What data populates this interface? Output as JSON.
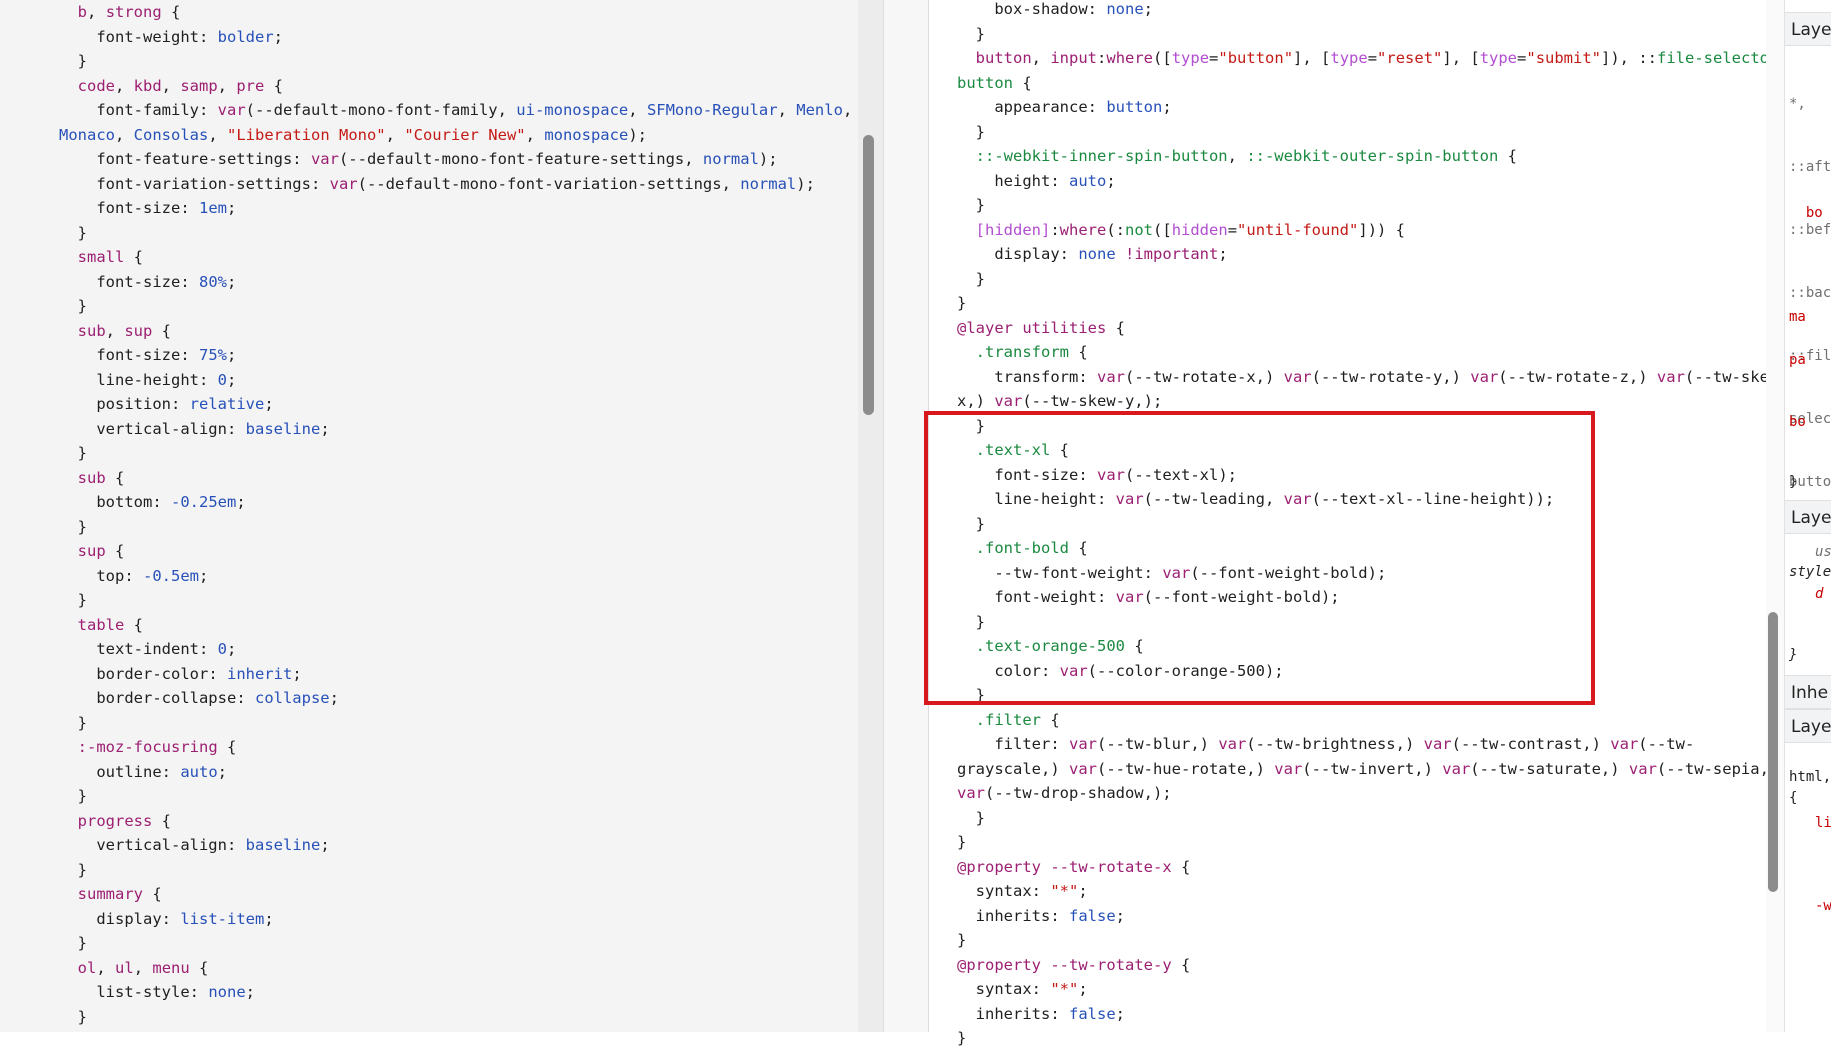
{
  "left_code_lines": [
    [
      [
        "  ",
        "t"
      ],
      [
        "b",
        "s"
      ],
      [
        ", ",
        "t"
      ],
      [
        "strong",
        "s"
      ],
      [
        " {",
        "t"
      ]
    ],
    [
      [
        "    ",
        "t"
      ],
      [
        "font-weight",
        "p"
      ],
      [
        ": ",
        "t"
      ],
      [
        "bolder",
        "v"
      ],
      [
        ";",
        "t"
      ]
    ],
    [
      [
        "  }",
        "t"
      ]
    ],
    [
      [
        "  ",
        "t"
      ],
      [
        "code",
        "s"
      ],
      [
        ", ",
        "t"
      ],
      [
        "kbd",
        "s"
      ],
      [
        ", ",
        "t"
      ],
      [
        "samp",
        "s"
      ],
      [
        ", ",
        "t"
      ],
      [
        "pre",
        "s"
      ],
      [
        " {",
        "t"
      ]
    ],
    [
      [
        "    ",
        "t"
      ],
      [
        "font-family",
        "p"
      ],
      [
        ": ",
        "t"
      ],
      [
        "var",
        "s"
      ],
      [
        "(--default-mono-font-family, ",
        "t"
      ],
      [
        "ui-monospace",
        "v"
      ],
      [
        ", ",
        "t"
      ],
      [
        "SFMono-Regular",
        "v"
      ],
      [
        ", ",
        "t"
      ],
      [
        "Menlo",
        "v"
      ],
      [
        ",",
        "t"
      ]
    ],
    [
      [
        "Monaco",
        "v"
      ],
      [
        ", ",
        "t"
      ],
      [
        "Consolas",
        "v"
      ],
      [
        ", ",
        "t"
      ],
      [
        "\"Liberation Mono\"",
        "q"
      ],
      [
        ", ",
        "t"
      ],
      [
        "\"Courier New\"",
        "q"
      ],
      [
        ", ",
        "t"
      ],
      [
        "monospace",
        "v"
      ],
      [
        ");",
        "t"
      ]
    ],
    [
      [
        "    ",
        "t"
      ],
      [
        "font-feature-settings",
        "p"
      ],
      [
        ": ",
        "t"
      ],
      [
        "var",
        "s"
      ],
      [
        "(--default-mono-font-feature-settings, ",
        "t"
      ],
      [
        "normal",
        "v"
      ],
      [
        ");",
        "t"
      ]
    ],
    [
      [
        "    ",
        "t"
      ],
      [
        "font-variation-settings",
        "p"
      ],
      [
        ": ",
        "t"
      ],
      [
        "var",
        "s"
      ],
      [
        "(--default-mono-font-variation-settings, ",
        "t"
      ],
      [
        "normal",
        "v"
      ],
      [
        ");",
        "t"
      ]
    ],
    [
      [
        "    ",
        "t"
      ],
      [
        "font-size",
        "p"
      ],
      [
        ": ",
        "t"
      ],
      [
        "1em",
        "v"
      ],
      [
        ";",
        "t"
      ]
    ],
    [
      [
        "  }",
        "t"
      ]
    ],
    [
      [
        "  ",
        "t"
      ],
      [
        "small",
        "s"
      ],
      [
        " {",
        "t"
      ]
    ],
    [
      [
        "    ",
        "t"
      ],
      [
        "font-size",
        "p"
      ],
      [
        ": ",
        "t"
      ],
      [
        "80%",
        "v"
      ],
      [
        ";",
        "t"
      ]
    ],
    [
      [
        "  }",
        "t"
      ]
    ],
    [
      [
        "  ",
        "t"
      ],
      [
        "sub",
        "s"
      ],
      [
        ", ",
        "t"
      ],
      [
        "sup",
        "s"
      ],
      [
        " {",
        "t"
      ]
    ],
    [
      [
        "    ",
        "t"
      ],
      [
        "font-size",
        "p"
      ],
      [
        ": ",
        "t"
      ],
      [
        "75%",
        "v"
      ],
      [
        ";",
        "t"
      ]
    ],
    [
      [
        "    ",
        "t"
      ],
      [
        "line-height",
        "p"
      ],
      [
        ": ",
        "t"
      ],
      [
        "0",
        "v"
      ],
      [
        ";",
        "t"
      ]
    ],
    [
      [
        "    ",
        "t"
      ],
      [
        "position",
        "p"
      ],
      [
        ": ",
        "t"
      ],
      [
        "relative",
        "v"
      ],
      [
        ";",
        "t"
      ]
    ],
    [
      [
        "    ",
        "t"
      ],
      [
        "vertical-align",
        "p"
      ],
      [
        ": ",
        "t"
      ],
      [
        "baseline",
        "v"
      ],
      [
        ";",
        "t"
      ]
    ],
    [
      [
        "  }",
        "t"
      ]
    ],
    [
      [
        "  ",
        "t"
      ],
      [
        "sub",
        "s"
      ],
      [
        " {",
        "t"
      ]
    ],
    [
      [
        "    ",
        "t"
      ],
      [
        "bottom",
        "p"
      ],
      [
        ": ",
        "t"
      ],
      [
        "-0.25em",
        "v"
      ],
      [
        ";",
        "t"
      ]
    ],
    [
      [
        "  }",
        "t"
      ]
    ],
    [
      [
        "  ",
        "t"
      ],
      [
        "sup",
        "s"
      ],
      [
        " {",
        "t"
      ]
    ],
    [
      [
        "    ",
        "t"
      ],
      [
        "top",
        "p"
      ],
      [
        ": ",
        "t"
      ],
      [
        "-0.5em",
        "v"
      ],
      [
        ";",
        "t"
      ]
    ],
    [
      [
        "  }",
        "t"
      ]
    ],
    [
      [
        "  ",
        "t"
      ],
      [
        "table",
        "s"
      ],
      [
        " {",
        "t"
      ]
    ],
    [
      [
        "    ",
        "t"
      ],
      [
        "text-indent",
        "p"
      ],
      [
        ": ",
        "t"
      ],
      [
        "0",
        "v"
      ],
      [
        ";",
        "t"
      ]
    ],
    [
      [
        "    ",
        "t"
      ],
      [
        "border-color",
        "p"
      ],
      [
        ": ",
        "t"
      ],
      [
        "inherit",
        "v"
      ],
      [
        ";",
        "t"
      ]
    ],
    [
      [
        "    ",
        "t"
      ],
      [
        "border-collapse",
        "p"
      ],
      [
        ": ",
        "t"
      ],
      [
        "collapse",
        "v"
      ],
      [
        ";",
        "t"
      ]
    ],
    [
      [
        "  }",
        "t"
      ]
    ],
    [
      [
        "  ",
        "t"
      ],
      [
        ":-moz-focusring",
        "s"
      ],
      [
        " {",
        "t"
      ]
    ],
    [
      [
        "    ",
        "t"
      ],
      [
        "outline",
        "p"
      ],
      [
        ": ",
        "t"
      ],
      [
        "auto",
        "v"
      ],
      [
        ";",
        "t"
      ]
    ],
    [
      [
        "  }",
        "t"
      ]
    ],
    [
      [
        "  ",
        "t"
      ],
      [
        "progress",
        "s"
      ],
      [
        " {",
        "t"
      ]
    ],
    [
      [
        "    ",
        "t"
      ],
      [
        "vertical-align",
        "p"
      ],
      [
        ": ",
        "t"
      ],
      [
        "baseline",
        "v"
      ],
      [
        ";",
        "t"
      ]
    ],
    [
      [
        "  }",
        "t"
      ]
    ],
    [
      [
        "  ",
        "t"
      ],
      [
        "summary",
        "s"
      ],
      [
        " {",
        "t"
      ]
    ],
    [
      [
        "    ",
        "t"
      ],
      [
        "display",
        "p"
      ],
      [
        ": ",
        "t"
      ],
      [
        "list-item",
        "v"
      ],
      [
        ";",
        "t"
      ]
    ],
    [
      [
        "  }",
        "t"
      ]
    ],
    [
      [
        "  ",
        "t"
      ],
      [
        "ol",
        "s"
      ],
      [
        ", ",
        "t"
      ],
      [
        "ul",
        "s"
      ],
      [
        ", ",
        "t"
      ],
      [
        "menu",
        "s"
      ],
      [
        " {",
        "t"
      ]
    ],
    [
      [
        "    ",
        "t"
      ],
      [
        "list-style",
        "p"
      ],
      [
        ": ",
        "t"
      ],
      [
        "none",
        "v"
      ],
      [
        ";",
        "t"
      ]
    ],
    [
      [
        "  }",
        "t"
      ]
    ]
  ],
  "right_code_lines": [
    [
      [
        "    ",
        "t"
      ],
      [
        "box-shadow",
        "p"
      ],
      [
        ": ",
        "t"
      ],
      [
        "none",
        "v"
      ],
      [
        ";",
        "t"
      ]
    ],
    [
      [
        "  }",
        "t"
      ]
    ],
    [
      [
        "  ",
        "t"
      ],
      [
        "button",
        "s"
      ],
      [
        ", ",
        "t"
      ],
      [
        "input",
        "s"
      ],
      [
        ":",
        "t"
      ],
      [
        "where",
        "s"
      ],
      [
        "([",
        "t"
      ],
      [
        "type",
        "a"
      ],
      [
        "=",
        "t"
      ],
      [
        "\"button\"",
        "q"
      ],
      [
        "], [",
        "t"
      ],
      [
        "type",
        "a"
      ],
      [
        "=",
        "t"
      ],
      [
        "\"reset\"",
        "q"
      ],
      [
        "], [",
        "t"
      ],
      [
        "type",
        "a"
      ],
      [
        "=",
        "t"
      ],
      [
        "\"submit\"",
        "q"
      ],
      [
        "]), ::",
        "t"
      ],
      [
        "file-selector-",
        "c"
      ]
    ],
    [
      [
        "button",
        "c"
      ],
      [
        " {",
        "t"
      ]
    ],
    [
      [
        "    ",
        "t"
      ],
      [
        "appearance",
        "p"
      ],
      [
        ": ",
        "t"
      ],
      [
        "button",
        "v"
      ],
      [
        ";",
        "t"
      ]
    ],
    [
      [
        "  }",
        "t"
      ]
    ],
    [
      [
        "  ",
        "t"
      ],
      [
        "::-webkit-inner-spin-button",
        "c"
      ],
      [
        ", ",
        "t"
      ],
      [
        "::-webkit-outer-spin-button",
        "c"
      ],
      [
        " {",
        "t"
      ]
    ],
    [
      [
        "    ",
        "t"
      ],
      [
        "height",
        "p"
      ],
      [
        ": ",
        "t"
      ],
      [
        "auto",
        "v"
      ],
      [
        ";",
        "t"
      ]
    ],
    [
      [
        "  }",
        "t"
      ]
    ],
    [
      [
        "  ",
        "t"
      ],
      [
        "[hidden]",
        "a"
      ],
      [
        ":",
        "t"
      ],
      [
        "where",
        "s"
      ],
      [
        "(:",
        "t"
      ],
      [
        "not",
        "c"
      ],
      [
        "([",
        "t"
      ],
      [
        "hidden",
        "a"
      ],
      [
        "=",
        "t"
      ],
      [
        "\"until-found\"",
        "q"
      ],
      [
        "])) {",
        "t"
      ]
    ],
    [
      [
        "    ",
        "t"
      ],
      [
        "display",
        "p"
      ],
      [
        ": ",
        "t"
      ],
      [
        "none",
        "v"
      ],
      [
        " ",
        "t"
      ],
      [
        "!important",
        "s"
      ],
      [
        ";",
        "t"
      ]
    ],
    [
      [
        "  }",
        "t"
      ]
    ],
    [
      [
        "}",
        "t"
      ]
    ],
    [
      [
        "@layer",
        "s"
      ],
      [
        " ",
        "t"
      ],
      [
        "utilities",
        "s"
      ],
      [
        " {",
        "t"
      ]
    ],
    [
      [
        "  ",
        "t"
      ],
      [
        ".transform",
        "c"
      ],
      [
        " {",
        "t"
      ]
    ],
    [
      [
        "    ",
        "t"
      ],
      [
        "transform",
        "p"
      ],
      [
        ": ",
        "t"
      ],
      [
        "var",
        "s"
      ],
      [
        "(--tw-rotate-x,) ",
        "t"
      ],
      [
        "var",
        "s"
      ],
      [
        "(--tw-rotate-y,) ",
        "t"
      ],
      [
        "var",
        "s"
      ],
      [
        "(--tw-rotate-z,) ",
        "t"
      ],
      [
        "var",
        "s"
      ],
      [
        "(--tw-skew-",
        "t"
      ]
    ],
    [
      [
        "x,) ",
        "t"
      ],
      [
        "var",
        "s"
      ],
      [
        "(--tw-skew-y,);",
        "t"
      ]
    ],
    [
      [
        "  }",
        "t"
      ]
    ],
    [
      [
        "  ",
        "t"
      ],
      [
        ".text-xl",
        "c"
      ],
      [
        " {",
        "t"
      ]
    ],
    [
      [
        "    ",
        "t"
      ],
      [
        "font-size",
        "p"
      ],
      [
        ": ",
        "t"
      ],
      [
        "var",
        "s"
      ],
      [
        "(--text-xl);",
        "t"
      ]
    ],
    [
      [
        "    ",
        "t"
      ],
      [
        "line-height",
        "p"
      ],
      [
        ": ",
        "t"
      ],
      [
        "var",
        "s"
      ],
      [
        "(--tw-leading, ",
        "t"
      ],
      [
        "var",
        "s"
      ],
      [
        "(--text-xl--line-height));",
        "t"
      ]
    ],
    [
      [
        "  }",
        "t"
      ]
    ],
    [
      [
        "  ",
        "t"
      ],
      [
        ".font-bold",
        "c"
      ],
      [
        " {",
        "t"
      ]
    ],
    [
      [
        "    ",
        "t"
      ],
      [
        "--tw-font-weight",
        "p"
      ],
      [
        ": ",
        "t"
      ],
      [
        "var",
        "s"
      ],
      [
        "(--font-weight-bold);",
        "t"
      ]
    ],
    [
      [
        "    ",
        "t"
      ],
      [
        "font-weight",
        "p"
      ],
      [
        ": ",
        "t"
      ],
      [
        "var",
        "s"
      ],
      [
        "(--font-weight-bold);",
        "t"
      ]
    ],
    [
      [
        "  }",
        "t"
      ]
    ],
    [
      [
        "  ",
        "t"
      ],
      [
        ".text-orange-500",
        "c"
      ],
      [
        " {",
        "t"
      ]
    ],
    [
      [
        "    ",
        "t"
      ],
      [
        "color",
        "p"
      ],
      [
        ": ",
        "t"
      ],
      [
        "var",
        "s"
      ],
      [
        "(--color-orange-500);",
        "t"
      ]
    ],
    [
      [
        "  }",
        "t"
      ]
    ],
    [
      [
        "  ",
        "t"
      ],
      [
        ".filter",
        "c"
      ],
      [
        " {",
        "t"
      ]
    ],
    [
      [
        "    ",
        "t"
      ],
      [
        "filter",
        "p"
      ],
      [
        ": ",
        "t"
      ],
      [
        "var",
        "s"
      ],
      [
        "(--tw-blur,) ",
        "t"
      ],
      [
        "var",
        "s"
      ],
      [
        "(--tw-brightness,) ",
        "t"
      ],
      [
        "var",
        "s"
      ],
      [
        "(--tw-contrast,) ",
        "t"
      ],
      [
        "var",
        "s"
      ],
      [
        "(--tw-",
        "t"
      ]
    ],
    [
      [
        "grayscale,) ",
        "t"
      ],
      [
        "var",
        "s"
      ],
      [
        "(--tw-hue-rotate,) ",
        "t"
      ],
      [
        "var",
        "s"
      ],
      [
        "(--tw-invert,) ",
        "t"
      ],
      [
        "var",
        "s"
      ],
      [
        "(--tw-saturate,) ",
        "t"
      ],
      [
        "var",
        "s"
      ],
      [
        "(--tw-sepia,)",
        "t"
      ]
    ],
    [
      [
        "var",
        "s"
      ],
      [
        "(--tw-drop-shadow,);",
        "t"
      ]
    ],
    [
      [
        "  }",
        "t"
      ]
    ],
    [
      [
        "}",
        "t"
      ]
    ],
    [
      [
        "@property",
        "s"
      ],
      [
        " ",
        "t"
      ],
      [
        "--tw-rotate-x",
        "s"
      ],
      [
        " {",
        "t"
      ]
    ],
    [
      [
        "  ",
        "t"
      ],
      [
        "syntax",
        "p"
      ],
      [
        ": ",
        "t"
      ],
      [
        "\"*\"",
        "q"
      ],
      [
        ";",
        "t"
      ]
    ],
    [
      [
        "  ",
        "t"
      ],
      [
        "inherits",
        "p"
      ],
      [
        ": ",
        "t"
      ],
      [
        "false",
        "v"
      ],
      [
        ";",
        "t"
      ]
    ],
    [
      [
        "}",
        "t"
      ]
    ],
    [
      [
        "@property",
        "s"
      ],
      [
        " ",
        "t"
      ],
      [
        "--tw-rotate-y",
        "s"
      ],
      [
        " {",
        "t"
      ]
    ],
    [
      [
        "  ",
        "t"
      ],
      [
        "syntax",
        "p"
      ],
      [
        ": ",
        "t"
      ],
      [
        "\"*\"",
        "q"
      ],
      [
        ";",
        "t"
      ]
    ],
    [
      [
        "  ",
        "t"
      ],
      [
        "inherits",
        "p"
      ],
      [
        ": ",
        "t"
      ],
      [
        "false",
        "v"
      ],
      [
        ";",
        "t"
      ]
    ],
    [
      [
        "}",
        "t"
      ]
    ]
  ],
  "side_panel": {
    "headers": [
      "Laye",
      "Laye",
      "Inhe",
      "Laye"
    ],
    "lines": [
      "*,",
      "::aft",
      "::bef",
      "::bac",
      "::fil",
      "selec",
      "butto",
      "  bo",
      "ma",
      "pa",
      "bo",
      "}",
      "us",
      "style",
      "d",
      "}",
      "html,",
      "{",
      "li",
      "-w"
    ]
  },
  "colors": {
    "highlight": "#d7191e"
  }
}
